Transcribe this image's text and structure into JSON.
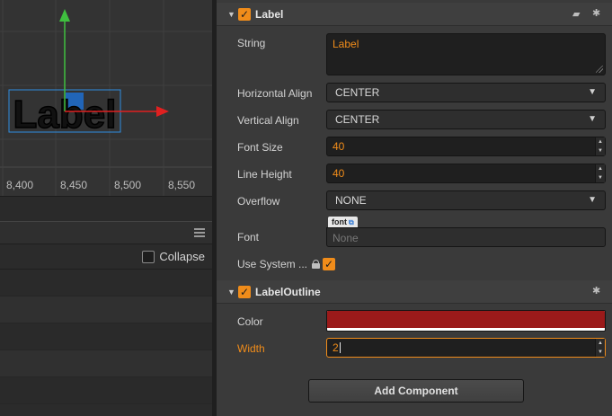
{
  "scene": {
    "ruler_ticks": [
      "8,400",
      "8,450",
      "8,500",
      "8,550"
    ],
    "label_node_text": "Label"
  },
  "bottom_panel": {
    "collapse_label": "Collapse"
  },
  "inspector": {
    "label_component": {
      "title": "Label",
      "enabled": true,
      "properties": {
        "string_label": "String",
        "string_value": "Label",
        "h_align_label": "Horizontal Align",
        "h_align_value": "CENTER",
        "v_align_label": "Vertical Align",
        "v_align_value": "CENTER",
        "font_size_label": "Font Size",
        "font_size_value": "40",
        "line_height_label": "Line Height",
        "line_height_value": "40",
        "overflow_label": "Overflow",
        "overflow_value": "NONE",
        "font_label": "Font",
        "font_tag": "font",
        "font_value": "None",
        "use_system_font_label": "Use System ...",
        "use_system_font_checked": true
      }
    },
    "label_outline_component": {
      "title": "LabelOutline",
      "enabled": true,
      "properties": {
        "color_label": "Color",
        "color_value": "#9b1a1a",
        "width_label": "Width",
        "width_value": "2"
      }
    },
    "add_component_label": "Add Component"
  },
  "colors": {
    "accent": "#f08c1a",
    "outline_color": "#9b1a1a",
    "gizmo_x": "#e02020",
    "gizmo_y": "#3fbf3f"
  }
}
